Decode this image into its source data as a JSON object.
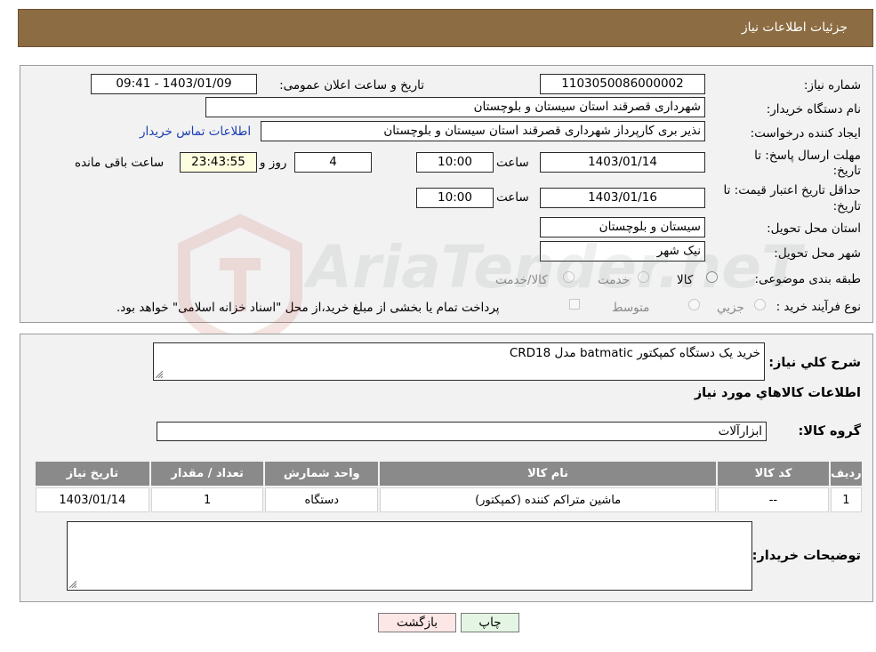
{
  "header": {
    "title": "جزئیات اطلاعات نیاز"
  },
  "form": {
    "need_number_label": "شماره نیاز:",
    "need_number": "1103050086000002",
    "announce_label": "تاریخ و ساعت اعلان عمومی:",
    "announce_value": "1403/01/09 - 09:41",
    "buyer_org_label": "نام دستگاه خریدار:",
    "buyer_org": "شهرداری قصرقند استان سیستان و بلوچستان",
    "creator_label": "ایجاد کننده درخواست:",
    "creator": "نذیر بری کارپرداز شهرداری قصرقند استان سیستان و بلوچستان",
    "contact_link": "اطلاعات تماس خریدار",
    "deadline_label_1": "مهلت ارسال پاسخ: تا",
    "deadline_label_2": "تاریخ:",
    "deadline_date": "1403/01/14",
    "time_label": "ساعت",
    "deadline_time": "10:00",
    "days_remaining": "4",
    "days_label": "روز و",
    "time_remaining": "23:43:55",
    "remaining_label": "ساعت باقی مانده",
    "validity_label_1": "حداقل تاریخ اعتبار قیمت: تا",
    "validity_label_2": "تاریخ:",
    "validity_date": "1403/01/16",
    "validity_time_label": "ساعت",
    "validity_time": "10:00",
    "province_label": "استان محل تحویل:",
    "province": "سیستان و بلوچستان",
    "city_label": "شهر محل تحویل:",
    "city": "نیک شهر",
    "category_label": "طبقه بندی موضوعی:",
    "category_options": [
      "کالا",
      "خدمت",
      "کالا/خدمت"
    ],
    "process_label": "نوع فرآیند خرید :",
    "process_options": [
      "جزیي",
      "متوسط"
    ],
    "process_note": "پرداخت تمام یا بخشی از مبلغ خرید،از محل \"اسناد خزانه اسلامی\" خواهد بود."
  },
  "details": {
    "summary_label": "شرح کلي نياز:",
    "summary": "خرید یک دستگاه کمپکتور batmatic مدل CRD18",
    "goods_info_title": "اطلاعات کالاهاي مورد نياز",
    "goods_group_label": "گروه کالا:",
    "goods_group": "ابزارآلات",
    "table": {
      "headers": [
        "رديف",
        "کد کالا",
        "نام کالا",
        "واحد شمارش",
        "تعداد / مقدار",
        "تاریخ نیاز"
      ],
      "rows": [
        [
          "1",
          "--",
          "ماشین متراکم کننده (کمپکتور)",
          "دستگاه",
          "1",
          "1403/01/14"
        ]
      ]
    },
    "buyer_notes_label": "توضیحات خریدار:",
    "buyer_notes": ""
  },
  "buttons": {
    "print": "چاپ",
    "back": "بازگشت"
  },
  "watermark": {
    "text": "AriaTender.neT"
  },
  "colors": {
    "header_bg": "#8c6c42",
    "table_header_bg": "#8a8a8a",
    "back_button_bg": "#fde6e6",
    "print_button_bg": "#e4f5e4",
    "link": "#1a3db3"
  }
}
